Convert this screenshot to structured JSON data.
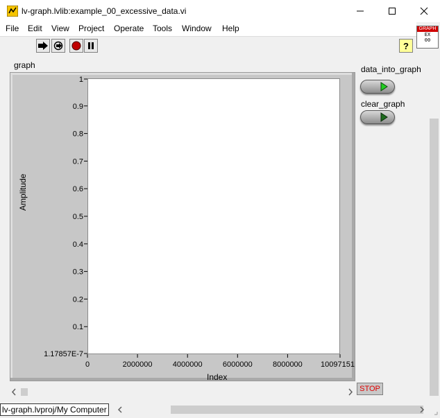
{
  "window": {
    "title": "lv-graph.lvlib:example_00_excessive_data.vi",
    "app_icon": "labview-vi-icon",
    "controls": {
      "minimize": "minimize-icon",
      "maximize": "maximize-icon",
      "close": "close-icon"
    }
  },
  "menu": {
    "items": [
      "File",
      "Edit",
      "View",
      "Project",
      "Operate",
      "Tools",
      "Window",
      "Help"
    ]
  },
  "toolbar": {
    "buttons": [
      "run-arrow-icon",
      "run-continuously-icon",
      "abort-icon",
      "pause-icon"
    ],
    "help_label": "?",
    "vi_icon_lines": [
      "GRAPH",
      "EX",
      "00"
    ]
  },
  "graph": {
    "label": "graph",
    "plot_bg": "#ffffff",
    "frame_color": "#c7c7c7"
  },
  "chart_data": {
    "type": "line",
    "title": "",
    "xlabel": "Index",
    "ylabel": "Amplitude",
    "x_ticks": [
      "0",
      "2000000",
      "4000000",
      "6000000",
      "8000000",
      "10097151"
    ],
    "y_ticks": [
      "1",
      "0.9",
      "0.8",
      "0.7",
      "0.6",
      "0.5",
      "0.4",
      "0.3",
      "0.2",
      "0.1",
      "1.17857E-7"
    ],
    "xlim": [
      0,
      10097151
    ],
    "ylim": [
      1.17857e-07,
      1
    ],
    "grid": false,
    "series": []
  },
  "controls": {
    "data_into_graph": {
      "label": "data_into_graph",
      "led_color": "#22cc22"
    },
    "clear_graph": {
      "label": "clear_graph",
      "led_color": "#1e6b1e"
    },
    "stop": {
      "label": "STOP",
      "color": "#e00000"
    }
  },
  "status": {
    "project_path": "lv-graph.lvproj/My Computer"
  }
}
